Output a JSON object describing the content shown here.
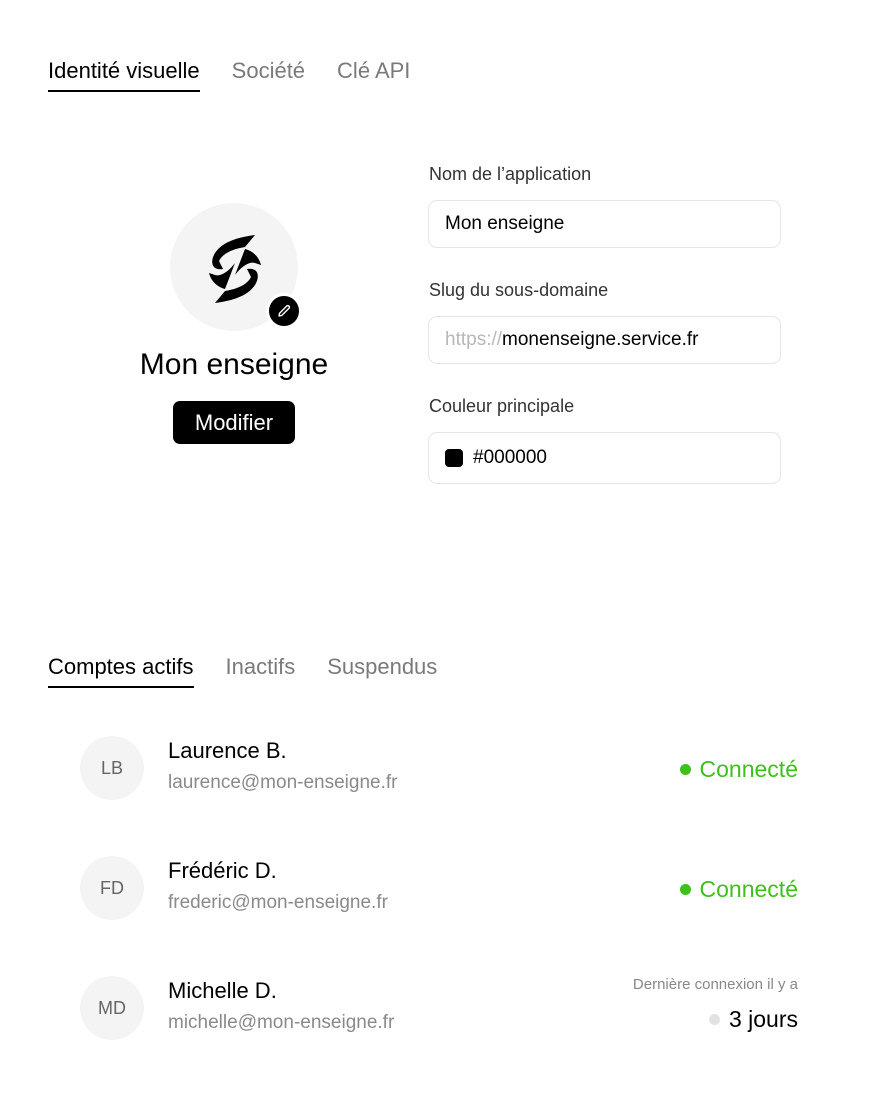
{
  "top_tabs": [
    {
      "label": "Identité visuelle",
      "active": true
    },
    {
      "label": "Société",
      "active": false
    },
    {
      "label": "Clé API",
      "active": false
    }
  ],
  "brand": {
    "logo_icon": "brand-swoosh-logo",
    "edit_icon": "pencil-icon",
    "name": "Mon enseigne",
    "modify_label": "Modifier"
  },
  "form": {
    "app_name": {
      "label": "Nom de l’application",
      "value": "Mon enseigne"
    },
    "slug": {
      "label": "Slug du sous-domaine",
      "prefix": "https://",
      "value": "monenseigne.service.fr"
    },
    "color": {
      "label": "Couleur principale",
      "value": "#000000",
      "swatch": "#000000"
    }
  },
  "account_tabs": [
    {
      "label": "Comptes actifs",
      "active": true
    },
    {
      "label": "Inactifs",
      "active": false
    },
    {
      "label": "Suspendus",
      "active": false
    }
  ],
  "accounts": [
    {
      "initials": "LB",
      "name": "Laurence B.",
      "email": "laurence@mon-enseigne.fr",
      "status": "Connecté",
      "status_color": "#3fc01c"
    },
    {
      "initials": "FD",
      "name": "Frédéric D.",
      "email": "frederic@mon-enseigne.fr",
      "status": "Connecté",
      "status_color": "#3fc01c"
    },
    {
      "initials": "MD",
      "name": "Michelle D.",
      "email": "michelle@mon-enseigne.fr",
      "last_label": "Dernière connexion il y a",
      "last_value": "3 jours"
    }
  ]
}
